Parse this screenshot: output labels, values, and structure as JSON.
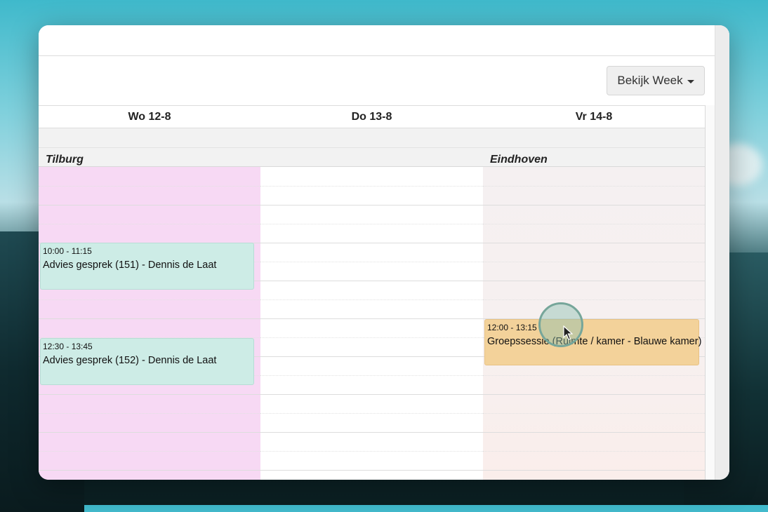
{
  "toolbar": {
    "view_button_label": "Bekijk Week"
  },
  "days": [
    {
      "label": "Wo 12-8",
      "location": "Tilburg"
    },
    {
      "label": "Do 13-8",
      "location": ""
    },
    {
      "label": "Vr 14-8",
      "location": "Eindhoven"
    }
  ],
  "events": [
    {
      "time": "10:00 - 11:15",
      "title": "Advies gesprek (151) - Dennis de Laat",
      "color": "#cdece6"
    },
    {
      "time": "12:30 - 13:45",
      "title": "Advies gesprek (152) - Dennis de Laat",
      "color": "#cdece6"
    },
    {
      "time": "12:00 - 13:15",
      "title": "Groepssessie (Ruimte / kamer - Blauwe kamer)",
      "color": "#f3d29a"
    }
  ],
  "colors": {
    "wednesday_bg": "#f7d9f4",
    "friday_bg": "#f5f0f1",
    "accent": "#76a69a"
  }
}
